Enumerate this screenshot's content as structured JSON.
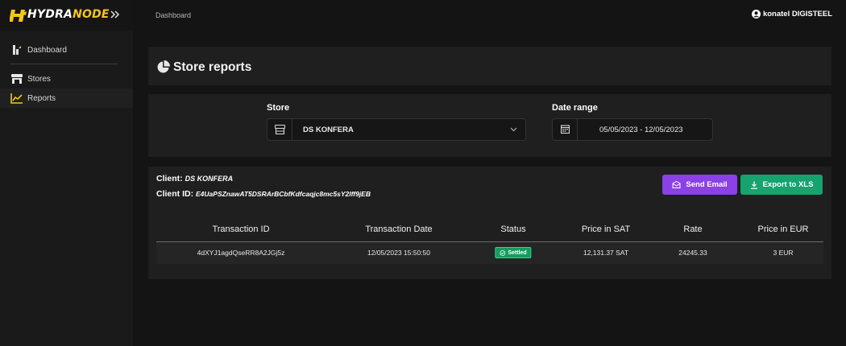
{
  "brand": {
    "name_part1": "HYDRA",
    "name_part2": "NODE",
    "accent": "#f5c518"
  },
  "sidebar": {
    "items": [
      {
        "label": "Dashboard",
        "icon": "dashboard-icon"
      },
      {
        "label": "Stores",
        "icon": "store-icon"
      },
      {
        "label": "Reports",
        "icon": "chart-line-icon",
        "active": true
      }
    ]
  },
  "header": {
    "breadcrumb": "Dashboard",
    "user": "konatel DIGISTEEL"
  },
  "page": {
    "title": "Store reports"
  },
  "filters": {
    "store_label": "Store",
    "store_value": "DS KONFERA",
    "date_label": "Date range",
    "date_value": "05/05/2023 - 12/05/2023"
  },
  "report": {
    "client_label": "Client:",
    "client_value": "DS KONFERA",
    "client_id_label": "Client ID:",
    "client_id_value": "E4UaPSZnawAT5DSRArBCbfKdfcaqjc8mc5sY2lff9jEB",
    "send_email_label": "Send Email",
    "export_label": "Export to XLS",
    "email_color": "#8b40e8",
    "export_color": "#16a36e"
  },
  "table": {
    "headers": [
      "Transaction ID",
      "Transaction Date",
      "Status",
      "Price in SAT",
      "Rate",
      "Price in EUR"
    ],
    "rows": [
      {
        "id": "4dXYJ1agdQseRR8A2JGj5z",
        "date": "12/05/2023 15:50:50",
        "status": "Settled",
        "price_sat": "12,131.37 SAT",
        "rate": "24245.33",
        "price_eur": "3 EUR"
      }
    ]
  }
}
